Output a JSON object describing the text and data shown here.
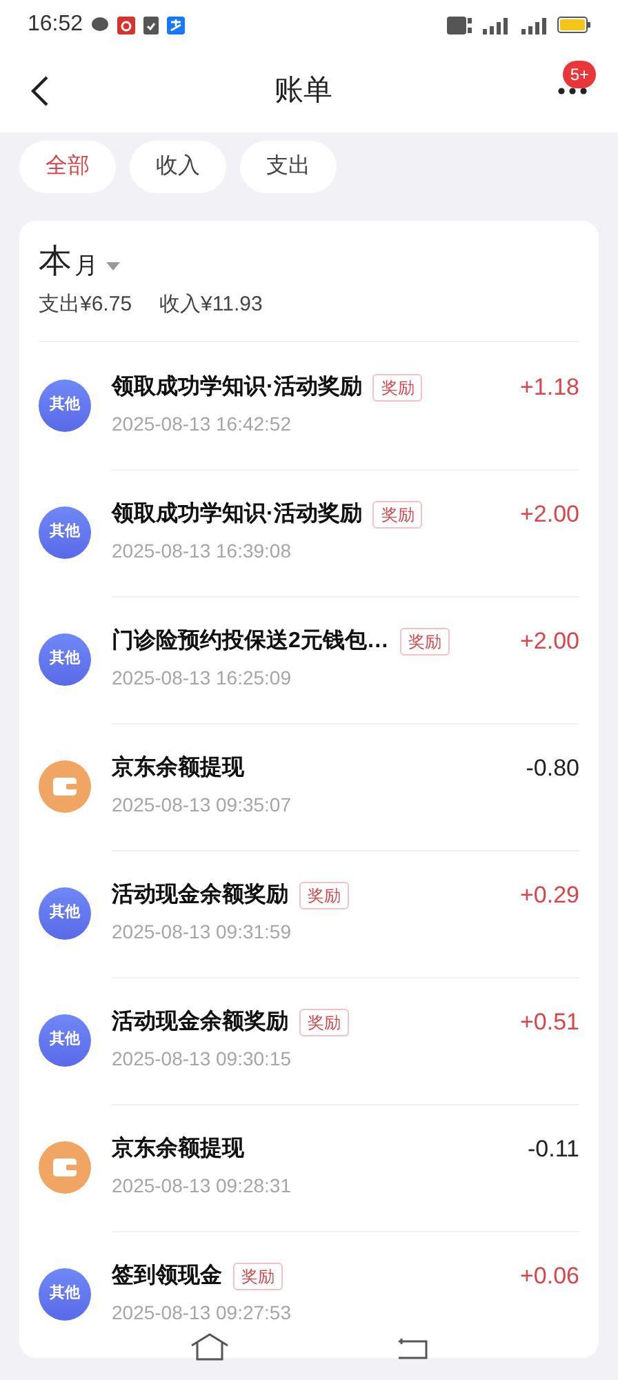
{
  "status_bar": {
    "time": "16:52"
  },
  "header": {
    "title": "账单",
    "badge": "5+"
  },
  "filters": [
    {
      "label": "全部",
      "selected": true
    },
    {
      "label": "收入",
      "selected": false
    },
    {
      "label": "支出",
      "selected": false
    }
  ],
  "summary": {
    "period_big": "本",
    "period_small": "月",
    "expense": "支出¥6.75",
    "income": "收入¥11.93"
  },
  "transactions": [
    {
      "kind": "other",
      "icon_label": "其他",
      "title": "领取成功学知识·活动奖励",
      "tag": "奖励",
      "time": "2025-08-13 16:42:52",
      "amount": "+1.18",
      "income": true
    },
    {
      "kind": "other",
      "icon_label": "其他",
      "title": "领取成功学知识·活动奖励",
      "tag": "奖励",
      "time": "2025-08-13 16:39:08",
      "amount": "+2.00",
      "income": true
    },
    {
      "kind": "other",
      "icon_label": "其他",
      "title": "门诊险预约投保送2元钱包…",
      "tag": "奖励",
      "time": "2025-08-13 16:25:09",
      "amount": "+2.00",
      "income": true
    },
    {
      "kind": "wallet",
      "title": "京东余额提现",
      "time": "2025-08-13 09:35:07",
      "amount": "-0.80",
      "income": false
    },
    {
      "kind": "other",
      "icon_label": "其他",
      "title": "活动现金余额奖励",
      "tag": "奖励",
      "time": "2025-08-13 09:31:59",
      "amount": "+0.29",
      "income": true
    },
    {
      "kind": "other",
      "icon_label": "其他",
      "title": "活动现金余额奖励",
      "tag": "奖励",
      "time": "2025-08-13 09:30:15",
      "amount": "+0.51",
      "income": true
    },
    {
      "kind": "wallet",
      "title": "京东余额提现",
      "time": "2025-08-13 09:28:31",
      "amount": "-0.11",
      "income": false
    },
    {
      "kind": "other",
      "icon_label": "其他",
      "title": "签到领现金",
      "tag": "奖励",
      "time": "2025-08-13 09:27:53",
      "amount": "+0.06",
      "income": true
    }
  ]
}
